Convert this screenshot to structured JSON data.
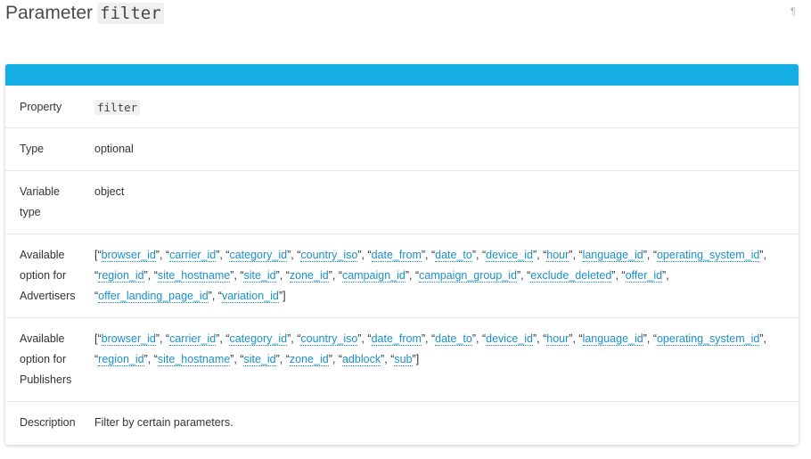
{
  "heading": {
    "prefix": "Parameter",
    "code": "filter",
    "anchor_glyph": "¶"
  },
  "table": {
    "property": {
      "label": "Property",
      "value": "filter"
    },
    "type": {
      "label": "Type",
      "value": "optional"
    },
    "variable_type": {
      "label_lines": [
        "Variable",
        "type"
      ],
      "value": "object"
    },
    "advertisers": {
      "label_lines": [
        "Available",
        "option for",
        "Advertisers"
      ],
      "options": [
        "browser_id",
        "carrier_id",
        "category_id",
        "country_iso",
        "date_from",
        "date_to",
        "device_id",
        "hour",
        "language_id",
        "operating_system_id",
        "region_id",
        "site_hostname",
        "site_id",
        "zone_id",
        "campaign_id",
        "campaign_group_id",
        "exclude_deleted",
        "offer_id",
        "offer_landing_page_id",
        "variation_id"
      ]
    },
    "publishers": {
      "label_lines": [
        "Available",
        "option for",
        "Publishers"
      ],
      "options": [
        "browser_id",
        "carrier_id",
        "category_id",
        "country_iso",
        "date_from",
        "date_to",
        "device_id",
        "hour",
        "language_id",
        "operating_system_id",
        "region_id",
        "site_hostname",
        "site_id",
        "zone_id",
        "adblock",
        "sub"
      ]
    },
    "description": {
      "label": "Description",
      "value": "Filter by certain parameters."
    }
  },
  "colors": {
    "header_bar": "#14aee4",
    "link": "#1a8fc9"
  }
}
